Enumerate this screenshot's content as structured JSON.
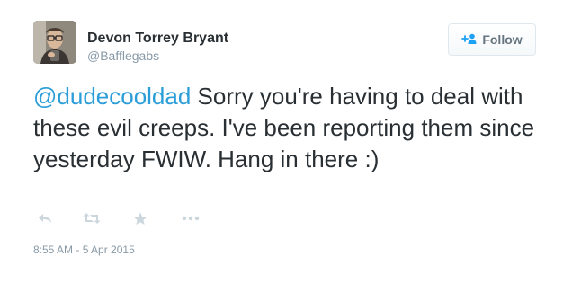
{
  "user": {
    "name": "Devon Torrey Bryant",
    "handle": "@Bafflegabs"
  },
  "follow_button": {
    "label": "Follow",
    "icon": "add-user-icon"
  },
  "tweet": {
    "mention": "@dudecooldad",
    "text": " Sorry you're having to deal with these evil creeps. I've been reporting them since yesterday FWIW. Hang in there :)",
    "timestamp": "8:55 AM - 5 Apr 2015"
  },
  "actions": [
    "reply-icon",
    "retweet-icon",
    "favorite-icon",
    "more-icon"
  ],
  "colors": {
    "link": "#2b9ed9",
    "text": "#292f33",
    "muted": "#8899a6",
    "action_icon": "#ccd6dd"
  }
}
